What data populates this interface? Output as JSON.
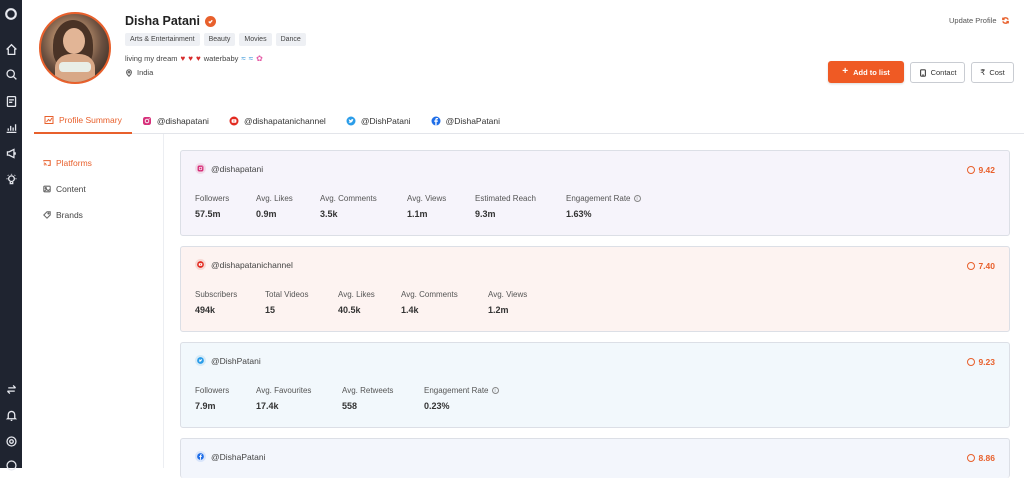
{
  "profile": {
    "name": "Disha Patani",
    "tags": [
      "Arts & Entertainment",
      "Beauty",
      "Movies",
      "Dance"
    ],
    "bio_prefix": "living my dream",
    "bio_word": "waterbaby",
    "location": "India",
    "update_label": "Update Profile"
  },
  "actions": {
    "add_label": "Add to list",
    "contact_label": "Contact",
    "cost_label": "Cost"
  },
  "tabs": [
    {
      "label": "Profile Summary",
      "icon": "summary-icon"
    },
    {
      "label": "@dishapatani",
      "icon": "instagram-icon"
    },
    {
      "label": "@dishapatanichannel",
      "icon": "youtube-icon"
    },
    {
      "label": "@DishPatani",
      "icon": "twitter-icon"
    },
    {
      "label": "@DishaPatani",
      "icon": "facebook-icon"
    }
  ],
  "sidebar": {
    "items": [
      {
        "label": "Platforms",
        "icon": "platforms-icon"
      },
      {
        "label": "Content",
        "icon": "image-icon"
      },
      {
        "label": "Brands",
        "icon": "tag-icon"
      }
    ]
  },
  "cards": [
    {
      "platform": "instagram",
      "handle": "@dishapatani",
      "score": "9.42",
      "stats": [
        {
          "label": "Followers",
          "value": "57.5m"
        },
        {
          "label": "Avg. Likes",
          "value": "0.9m"
        },
        {
          "label": "Avg. Comments",
          "value": "3.5k"
        },
        {
          "label": "Avg. Views",
          "value": "1.1m"
        },
        {
          "label": "Estimated Reach",
          "value": "9.3m"
        },
        {
          "label": "Engagement Rate",
          "value": "1.63%"
        }
      ]
    },
    {
      "platform": "youtube",
      "handle": "@dishapatanichannel",
      "score": "7.40",
      "stats": [
        {
          "label": "Subscribers",
          "value": "494k"
        },
        {
          "label": "Total Videos",
          "value": "15"
        },
        {
          "label": "Avg. Likes",
          "value": "40.5k"
        },
        {
          "label": "Avg. Comments",
          "value": "1.4k"
        },
        {
          "label": "Avg. Views",
          "value": "1.2m"
        }
      ]
    },
    {
      "platform": "twitter",
      "handle": "@DishPatani",
      "score": "9.23",
      "stats": [
        {
          "label": "Followers",
          "value": "7.9m"
        },
        {
          "label": "Avg. Favourites",
          "value": "17.4k"
        },
        {
          "label": "Avg. Retweets",
          "value": "558"
        },
        {
          "label": "Engagement Rate",
          "value": "0.23%"
        }
      ]
    },
    {
      "platform": "facebook",
      "handle": "@DishaPatani",
      "score": "8.86",
      "stats": []
    }
  ],
  "colors": {
    "accent": "#e8602c",
    "rail": "#1f2430",
    "instagram_bg": "#f6f4fb",
    "youtube_bg": "#fdf3f1",
    "twitter_bg": "#f2f8fc",
    "facebook_bg": "#f3f6fc"
  }
}
